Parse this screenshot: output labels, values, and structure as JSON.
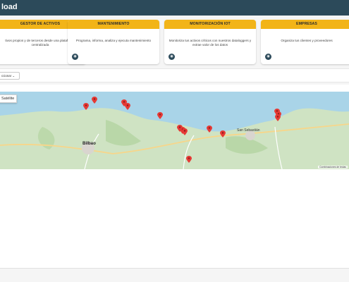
{
  "app": {
    "brand": "load"
  },
  "colors": {
    "topbar": "#2c4a5a",
    "card_header": "#f2b418",
    "pin": "#e53935",
    "sea": "#a9d4e8"
  },
  "cards": [
    {
      "title": "GESTOR DE ACTIVOS",
      "text": "tivos propios y de terceros desde una plataforma centralizada",
      "icon": "eye-icon"
    },
    {
      "title": "MANTENIMIENTO",
      "text": "Programa, informa, analiza y ejecuta mantenimiento",
      "icon": "eye-icon"
    },
    {
      "title": "MONITORIZACIÓN IOT",
      "text": "Monitoriza tus activos críticos con nuestros dataloggers y extrae valor de los datos",
      "icon": "eye-icon"
    },
    {
      "title": "EMPRESAS",
      "text": "Organiza tus clientes y proveedores",
      "icon": "eye-icon"
    }
  ],
  "filter": {
    "select_value": "ccionar",
    "chevron": "chevron-down-icon"
  },
  "map": {
    "satellite_label": "Satélite",
    "city_label": "Bilbao",
    "city_label2": "San Sebastián",
    "attribution": "Combinaciones de teclas",
    "pin_count": 15
  }
}
